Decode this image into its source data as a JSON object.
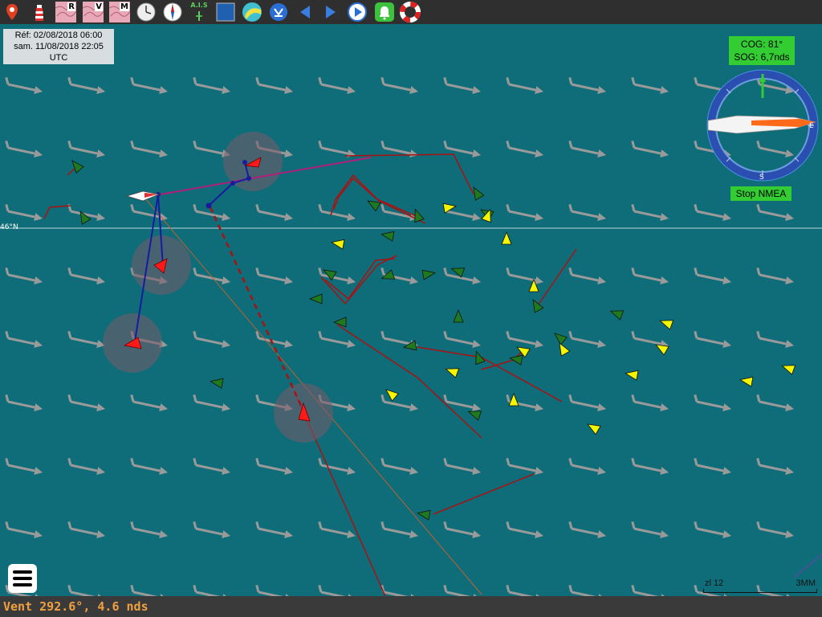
{
  "toolbar": {
    "icons": [
      "map-pin-icon",
      "lighthouse-icon",
      "chart-r-icon",
      "chart-v-icon",
      "chart-m-icon",
      "clock-icon",
      "compass-icon",
      "ais-icon",
      "square-icon",
      "weather-icon",
      "route-icon",
      "back-icon",
      "forward-icon",
      "play-icon",
      "bell-icon",
      "lifebuoy-icon"
    ],
    "chart_r_letter": "R",
    "chart_v_letter": "V",
    "chart_m_letter": "M",
    "ais_label": "A.I.S"
  },
  "info": {
    "ref_line": "Réf: 02/08/2018 06:00",
    "date_line": "sam. 11/08/2018 22:05",
    "tz_line": "UTC"
  },
  "instruments": {
    "cog": "COG: 81°",
    "sog": "SOG: 6,7nds",
    "stop_nmea": "Stop NMEA",
    "compass_n": "N",
    "compass_s": "S",
    "compass_e": "E"
  },
  "chart": {
    "latitude_label": "46°N",
    "scale_left": "zl 12",
    "scale_right": "3MM",
    "colors": {
      "sea": "#0e6d78",
      "wind_arrow": "#9a9a9a",
      "track": "#aa1111",
      "route": "#1a1aa0",
      "ally_boat": "#1f7a1f",
      "fleet_boat": "#f5f500",
      "mark": "#ff1a1a"
    }
  },
  "status": {
    "wind": "Vent 292.6°, 4.6 nds"
  }
}
